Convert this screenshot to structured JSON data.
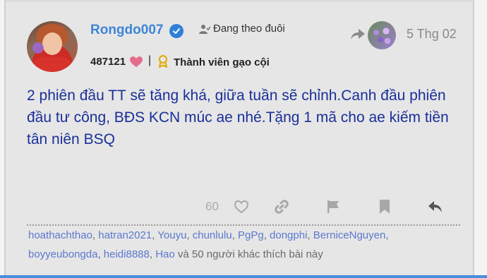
{
  "post": {
    "username": "Rongdo007",
    "follow_status": "Đang theo đuôi",
    "date": "5 Thg 02",
    "points": "487121",
    "separator": "|",
    "rank": "Thành viên gạo cội",
    "content": "2 phiên đầu TT sẽ tăng khá, giữa tuần sẽ chỉnh.Canh đầu phiên đầu tư công, BĐS KCN múc ae nhé.Tặng 1 mã cho ae kiếm tiền tân niên BSQ"
  },
  "actions": {
    "like_count": "60",
    "icons": [
      "heart-icon",
      "link-icon",
      "flag-icon",
      "bookmark-icon",
      "reply-icon"
    ]
  },
  "likers": {
    "names": [
      "hoathachthao",
      "hatran2021",
      "Youyu",
      "chunlulu",
      "PgPg",
      "dongphi",
      "BerniceNguyen",
      "boyyeubongda",
      "heidi8888",
      "Hao"
    ],
    "and_text": "và",
    "rest_text": "50 người khác thích bài này"
  },
  "colors": {
    "username": "#3d86d6",
    "content": "#1a2f9a",
    "liker": "#5c78cf",
    "background": "#e6e6e6"
  }
}
